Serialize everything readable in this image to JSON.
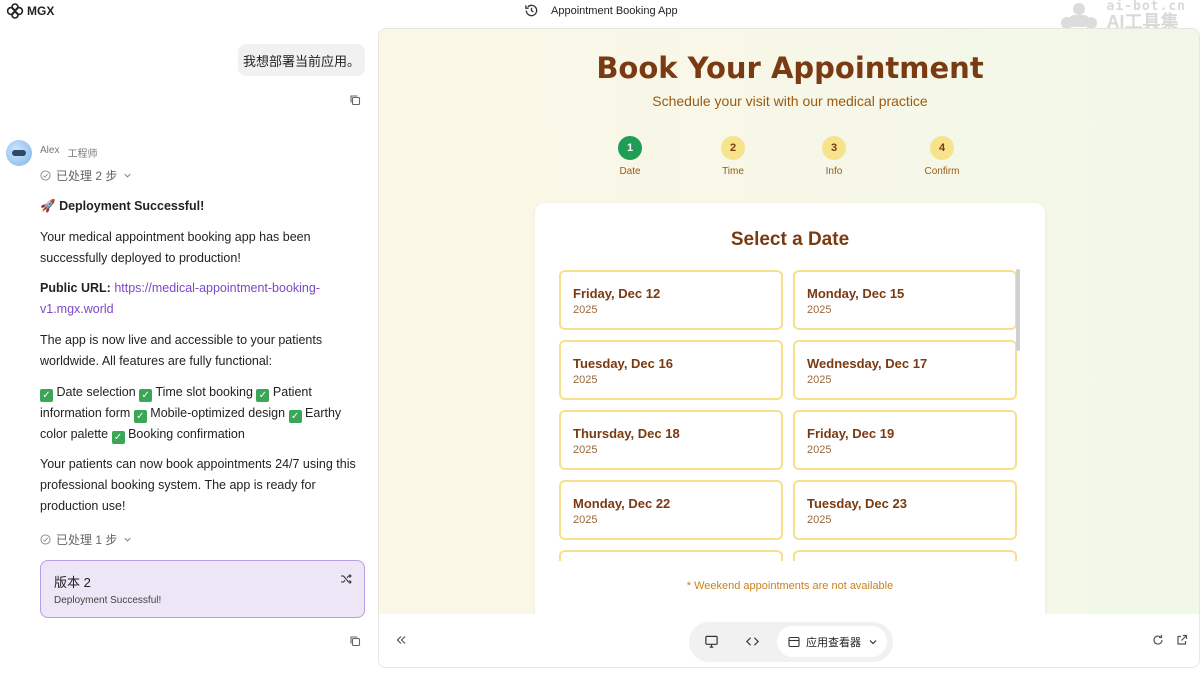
{
  "topbar": {
    "brand": "MGX",
    "app_title": "Appointment Booking App",
    "watermark_line1": "ai-bot.cn",
    "watermark_line2": "AI工具集"
  },
  "chat": {
    "user_message": "我想部署当前应用。",
    "agent": {
      "name": "Alex",
      "role": "工程师"
    },
    "processed_top": "已处理 2 步",
    "processed_bottom": "已处理 1 步",
    "heading_emoji": "🚀",
    "heading": "Deployment Successful!",
    "p1": "Your medical appointment booking app has been successfully deployed to production!",
    "url_label": "Public URL:",
    "url": "https://medical-appointment-booking-v1.mgx.world",
    "p2": "The app is now live and accessible to your patients worldwide. All features are fully functional:",
    "features": [
      "Date selection",
      "Time slot booking",
      "Patient information form",
      "Mobile-optimized design",
      "Earthy color palette",
      "Booking confirmation"
    ],
    "p3": "Your patients can now book appointments 24/7 using this professional booking system. The app is ready for production use!",
    "version": {
      "title": "版本 2",
      "subtitle": "Deployment Successful!"
    }
  },
  "preview": {
    "title": "Book Your Appointment",
    "subtitle": "Schedule your visit with our medical practice",
    "steps": [
      {
        "num": "1",
        "label": "Date"
      },
      {
        "num": "2",
        "label": "Time"
      },
      {
        "num": "3",
        "label": "Info"
      },
      {
        "num": "4",
        "label": "Confirm"
      }
    ],
    "card_title": "Select a Date",
    "dates": [
      {
        "day": "Friday, Dec 12",
        "year": "2025"
      },
      {
        "day": "Monday, Dec 15",
        "year": "2025"
      },
      {
        "day": "Tuesday, Dec 16",
        "year": "2025"
      },
      {
        "day": "Wednesday, Dec 17",
        "year": "2025"
      },
      {
        "day": "Thursday, Dec 18",
        "year": "2025"
      },
      {
        "day": "Friday, Dec 19",
        "year": "2025"
      },
      {
        "day": "Monday, Dec 22",
        "year": "2025"
      },
      {
        "day": "Tuesday, Dec 23",
        "year": "2025"
      },
      {
        "day": "",
        "year": ""
      },
      {
        "day": "",
        "year": ""
      }
    ],
    "note": "* Weekend appointments are not available",
    "viewer_label": "应用查看器",
    "colors": {
      "accent": "#7a3a12",
      "step_active": "#1f9d55",
      "step_inactive": "#f7e38c",
      "date_border": "#f6e08e"
    }
  }
}
